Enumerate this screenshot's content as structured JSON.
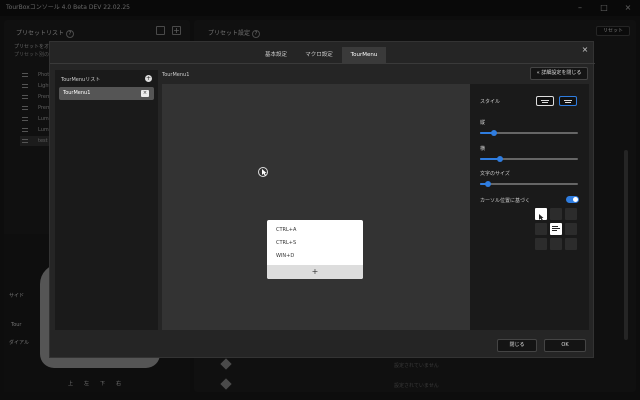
{
  "app": {
    "title": "TourBoxコンソール 4.0 Beta DEV 22.02.25"
  },
  "left_panel": {
    "header": "プリセットリスト",
    "help": "?",
    "sub1": "プリセットをオート…",
    "sub2": "プリセット別の設…",
    "items": [
      "Photosh…",
      "Lightr…",
      "Premi…",
      "Premi…",
      "Lumin…",
      "Lumin…",
      "test"
    ]
  },
  "device_labels": {
    "side": "サイド",
    "tour": "Tour",
    "dial": "ダイアル",
    "up": "上",
    "left": "左",
    "down": "下",
    "right": "右"
  },
  "right_panel": {
    "header": "プリセット設定",
    "help": "?",
    "reset": "リセット",
    "empty1": "設定されていません",
    "empty2": "設定されていません"
  },
  "dialog": {
    "tabs": [
      "基本設定",
      "マクロ設定",
      "TourMenu"
    ],
    "close_glyph": "×",
    "list_title": "TourMenuリスト",
    "add_glyph": "+",
    "list_items": [
      {
        "label": "TourMenu1",
        "remove": "×"
      }
    ],
    "canvas_title": "TourMenu1",
    "collapse_button": "詳細設定を閉じる",
    "collapse_glyph": "«",
    "menu_items": [
      "CTRL+A",
      "CTRL+S",
      "WIN+D"
    ],
    "menu_add": "+",
    "settings": {
      "style_label": "スタイル",
      "height_label": "縦",
      "height_value": 0.14,
      "width_label": "横",
      "width_value": 0.2,
      "font_label": "文字のサイズ",
      "font_value": 0.08,
      "cursor_label": "カーソル位置に基づく",
      "cursor_toggle": true
    },
    "close_button": "閉じる",
    "ok_button": "OK"
  },
  "colors": {
    "accent": "#2f7de0"
  }
}
